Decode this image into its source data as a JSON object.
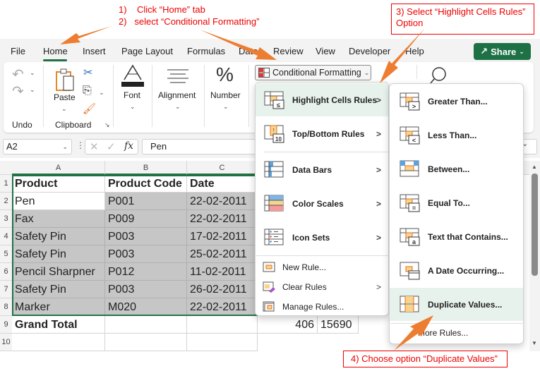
{
  "annotations": {
    "step1": "1)",
    "step1_text": "Click “Home” tab",
    "step2": "2)",
    "step2_text": "select “Conditional Formatting”",
    "step3": "3) Select “Highlight Cells Rules” Option",
    "step4": "4) Choose option “Duplicate Values”",
    "arrow_color": "#ED7D31",
    "text_color": "#E00000"
  },
  "tabs": [
    {
      "label": "File"
    },
    {
      "label": "Home",
      "active": true
    },
    {
      "label": "Insert"
    },
    {
      "label": "Page Layout"
    },
    {
      "label": "Formulas"
    },
    {
      "label": "Data"
    },
    {
      "label": "Review"
    },
    {
      "label": "View"
    },
    {
      "label": "Developer"
    },
    {
      "label": "Help"
    }
  ],
  "share": {
    "label": "Share",
    "color": "#1E7145"
  },
  "ribbon": {
    "undo_group": "Undo",
    "paste": "Paste",
    "clipboard_group": "Clipboard",
    "font": "Font",
    "alignment": "Alignment",
    "number": "Number",
    "conditional_formatting": "Conditional Formatting"
  },
  "formula_bar": {
    "name_box": "A2",
    "fx": "fx",
    "value": "Pen"
  },
  "sheet": {
    "columns": [
      "A",
      "B",
      "C"
    ],
    "rows": [
      {
        "num": "1",
        "cells": [
          "Product",
          "Product Code",
          "Date"
        ]
      },
      {
        "num": "2",
        "cells": [
          "Pen",
          "P001",
          "22-02-2011"
        ]
      },
      {
        "num": "3",
        "cells": [
          "Fax",
          "P009",
          "22-02-2011"
        ]
      },
      {
        "num": "4",
        "cells": [
          "Safety Pin",
          "P003",
          "17-02-2011"
        ]
      },
      {
        "num": "5",
        "cells": [
          "Safety Pin",
          "P003",
          "25-02-2011"
        ]
      },
      {
        "num": "6",
        "cells": [
          "Pencil Sharpner",
          "P012",
          "11-02-2011"
        ]
      },
      {
        "num": "7",
        "cells": [
          "Safety Pin",
          "P003",
          "26-02-2011"
        ]
      },
      {
        "num": "8",
        "cells": [
          "Marker",
          "M020",
          "22-02-2011"
        ]
      },
      {
        "num": "9",
        "cells": [
          "Grand Total",
          "",
          ""
        ]
      },
      {
        "num": "10",
        "cells": [
          "",
          "",
          ""
        ]
      }
    ],
    "grand_total_values": [
      "406",
      "15690"
    ]
  },
  "cf_menu": {
    "items": [
      {
        "label": "Highlight Cells Rules",
        "has_submenu": true
      },
      {
        "label": "Top/Bottom Rules",
        "has_submenu": true
      },
      {
        "label": "Data Bars",
        "has_submenu": true
      },
      {
        "label": "Color Scales",
        "has_submenu": true
      },
      {
        "label": "Icon Sets",
        "has_submenu": true
      }
    ],
    "small_items": [
      {
        "label": "New Rule..."
      },
      {
        "label": "Clear Rules",
        "has_submenu": true
      },
      {
        "label": "Manage Rules..."
      }
    ]
  },
  "hcr_submenu": {
    "items": [
      {
        "label": "Greater Than..."
      },
      {
        "label": "Less Than..."
      },
      {
        "label": "Between..."
      },
      {
        "label": "Equal To..."
      },
      {
        "label": "Text that Contains..."
      },
      {
        "label": "A Date Occurring..."
      },
      {
        "label": "Duplicate Values..."
      }
    ],
    "more": "More Rules..."
  }
}
